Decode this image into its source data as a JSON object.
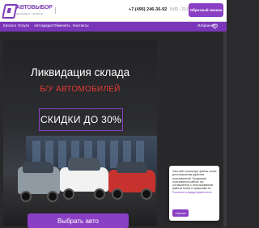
{
  "header": {
    "logo_title": "АВТОВЫБОР",
    "logo_subtitle": "автомобили с пробегом",
    "phone": "+7 (495) 246-36-92",
    "hours": "9:00 - 21:00",
    "callback_label": "Обратный звонок"
  },
  "nav": {
    "items": [
      {
        "label": "Каталог"
      },
      {
        "label": "Услуги"
      },
      {
        "label": "Автокредит"
      },
      {
        "label": "Обменять"
      },
      {
        "label": "Контакты"
      }
    ],
    "favorites_label": "Избранное"
  },
  "hero": {
    "title": "Ликвидация склада",
    "subtitle": "Б/У АВТОМОБИЛЕЙ",
    "discount_text": "СКИДКИ ДО 30%",
    "cta_label": "Выбрать авто"
  },
  "cookie": {
    "text": "Наш сайт использует файлы cookie для повышения удобства пользователей. Продолжая пользоваться сайтом, вы соглашаетесь с использованием файлов cookie и правилами по ",
    "link_text": "Политике конфиденциальности",
    "button_label": "Хорошо"
  },
  "colors": {
    "accent": "#8a3fc4",
    "nav_bg": "#7a36b8",
    "hero_red": "#e93a34"
  }
}
